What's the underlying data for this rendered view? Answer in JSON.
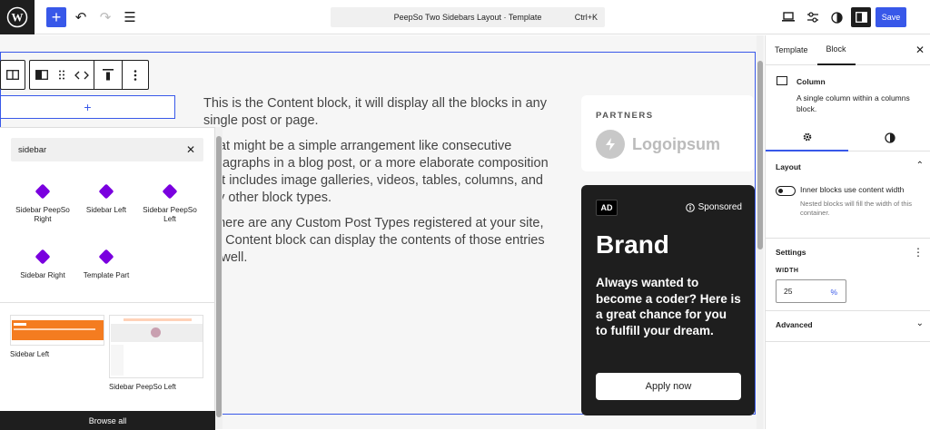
{
  "topbar": {
    "command_title": "PeepSo Two Sidebars Layout · Template",
    "command_shortcut": "Ctrl+K",
    "save_label": "Save",
    "add_icon": "+",
    "undo_icon": "↶",
    "redo_icon": "↷",
    "list_view_icon": "☰"
  },
  "canvas": {
    "appender_icon": "+",
    "content_paragraphs": [
      "This is the Content block, it will display all the blocks in any single post or page.",
      "That might be a simple arrangement like consecutive paragraphs in a blog post, or a more elaborate composition that includes image galleries, videos, tables, columns, and any other block types.",
      "If there are any Custom Post Types registered at your site, the Content block can display the contents of those entries as well."
    ],
    "partners_label": "PARTNERS",
    "partners_logo_text": "Logoipsum",
    "ad": {
      "badge": "AD",
      "sponsored": "Sponsored",
      "brand": "Brand",
      "description": "Always wanted to become a coder? Here is a great chance for you to fulfill your dream.",
      "cta": "Apply now"
    }
  },
  "inserter": {
    "search_value": "sidebar",
    "results": [
      {
        "label": "Sidebar PeepSo Right"
      },
      {
        "label": "Sidebar Left"
      },
      {
        "label": "Sidebar PeepSo Left"
      },
      {
        "label": "Sidebar Right"
      },
      {
        "label": "Template Part"
      }
    ],
    "patterns": [
      {
        "label": "Sidebar Left"
      },
      {
        "label": "Sidebar PeepSo Left"
      }
    ],
    "browse_all": "Browse all"
  },
  "panel": {
    "tabs": [
      "Template",
      "Block"
    ],
    "block_title": "Column",
    "block_desc": "A single column within a columns block.",
    "layout_heading": "Layout",
    "toggle_label": "Inner blocks use content width",
    "toggle_help": "Nested blocks will fill the width of this container.",
    "settings_heading": "Settings",
    "width_label": "WIDTH",
    "width_value": "25",
    "width_unit": "%",
    "advanced_heading": "Advanced"
  },
  "colors": {
    "accent": "#3858e9",
    "dark": "#1e1e1e",
    "block_icon": "#7a00df"
  }
}
